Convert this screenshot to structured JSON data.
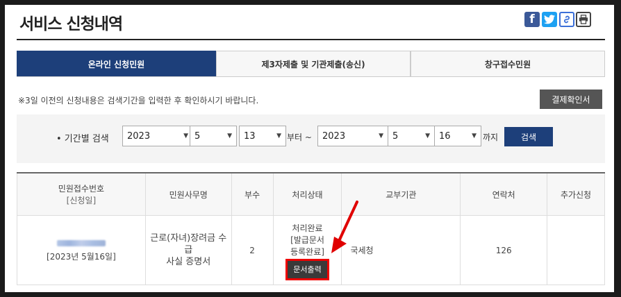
{
  "page": {
    "title": "서비스 신청내역"
  },
  "share": {
    "facebook": "f",
    "link": "🔗",
    "print": "🖶"
  },
  "tabs": [
    {
      "label": "온라인 신청민원",
      "active": true
    },
    {
      "label": "제3자제출 및 기관제출(송신)",
      "active": false
    },
    {
      "label": "창구접수민원",
      "active": false
    }
  ],
  "notice": "※3일 이전의 신청내용은 검색기간을 입력한 후 확인하시기 바랍니다.",
  "payment_button": "결제확인서",
  "search": {
    "label": "• 기간별 검색",
    "from": {
      "year": "2023",
      "month": "5",
      "day": "13"
    },
    "to": {
      "year": "2023",
      "month": "5",
      "day": "16"
    },
    "from_suffix": "부터 ~",
    "to_suffix": "까지",
    "button": "검색"
  },
  "table": {
    "headers": {
      "receipt_no": "민원접수번호",
      "receipt_date": "[신청일]",
      "service_name": "민원사무명",
      "copies": "부수",
      "status": "처리상태",
      "agency": "교부기관",
      "contact": "연락처",
      "extra": "추가신청"
    },
    "rows": [
      {
        "date": "[2023년 5월16일]",
        "service_line1": "근로(자녀)장려금 수급",
        "service_line2": "사실 증명서",
        "copies": "2",
        "status_line1": "처리완료",
        "status_line2": "[발급문서",
        "status_line3": "등록완료]",
        "print_button": "문서출력",
        "agency": "국세청",
        "contact": "126",
        "extra": ""
      }
    ]
  },
  "colors": {
    "accent": "#1d3f7a",
    "highlight": "#e00000"
  }
}
